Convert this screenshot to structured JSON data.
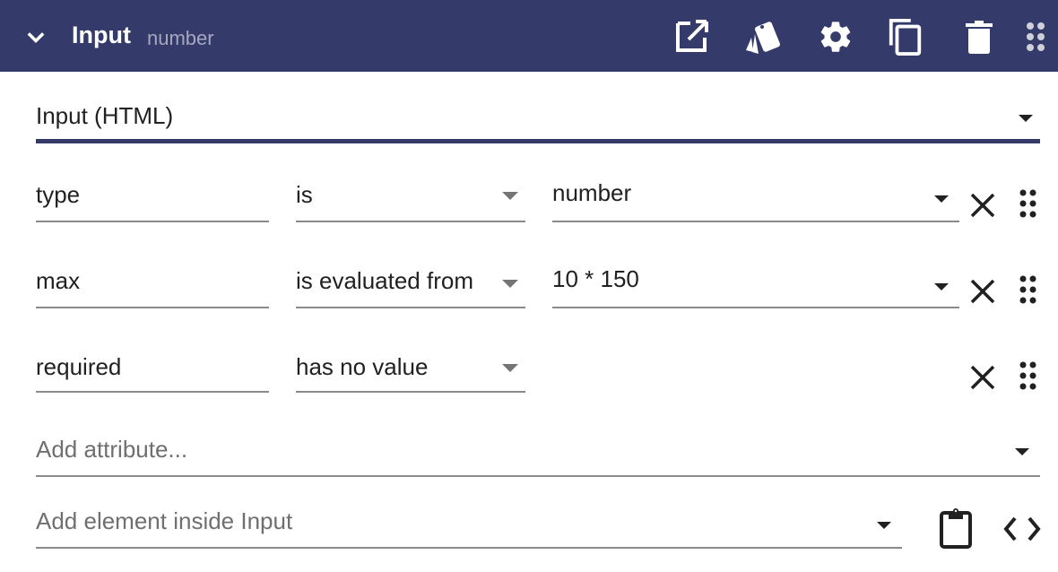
{
  "header": {
    "title": "Input",
    "subtitle": "number",
    "icons": [
      "chevron-down-icon",
      "open-external-icon",
      "style-swatch-icon",
      "settings-gear-icon",
      "duplicate-icon",
      "delete-trash-icon",
      "drag-handle-icon"
    ],
    "background": "#343b6b"
  },
  "element_type": {
    "value": "Input (HTML)",
    "accent": "#343b6b"
  },
  "attributes": [
    {
      "name": "type",
      "operator": "is",
      "value": "number"
    },
    {
      "name": "max",
      "operator": "is evaluated from",
      "value": "10 * 150"
    },
    {
      "name": "required",
      "operator": "has no value",
      "value": ""
    }
  ],
  "add_attribute": {
    "placeholder": "Add attribute..."
  },
  "add_element": {
    "placeholder": "Add element inside Input"
  },
  "footer_icons": [
    "clipboard-paste-icon",
    "code-view-icon"
  ]
}
